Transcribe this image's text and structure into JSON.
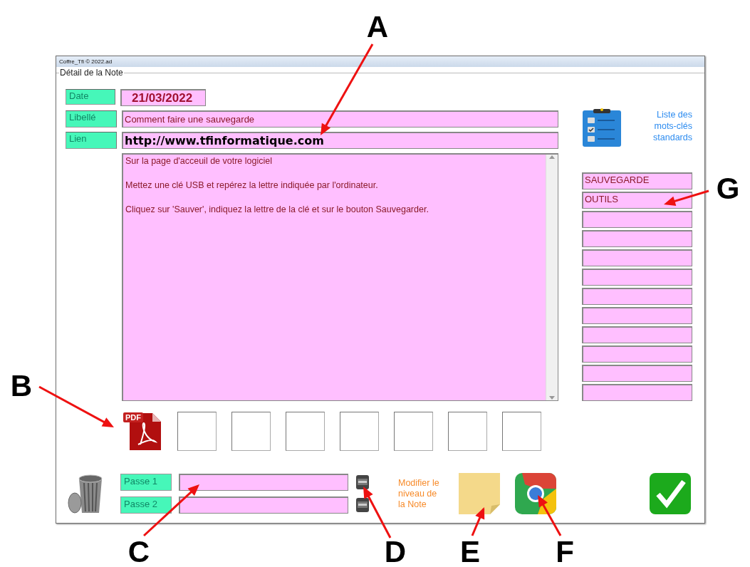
{
  "window": {
    "title": "Coffre_Tfi © 2022.ad"
  },
  "group": {
    "title": "Détail de la Note"
  },
  "fields": [
    {
      "label": "Date",
      "value": "21/03/2022",
      "kind": "date"
    },
    {
      "label": "Libellé",
      "value": "Comment faire une sauvegarde",
      "kind": "text"
    },
    {
      "label": "Lien",
      "value": "http://www.tfinformatique.com",
      "kind": "link"
    }
  ],
  "note": {
    "lines": [
      "Sur la page d'acceuil de votre logiciel",
      "Mettez une clé USB et repérez la lettre indiquée par l'ordinateur.",
      "Cliquez sur 'Sauver', indiquez la lettre de la clé et sur le bouton Sauvegarder."
    ]
  },
  "keywords": {
    "title": "Liste des mots-clés standards",
    "items": [
      "SAUVEGARDE",
      "OUTILS"
    ]
  },
  "attachments": [
    {
      "kind": "pdf",
      "label": "PDF"
    }
  ],
  "passwords": [
    {
      "label": "Passe 1"
    },
    {
      "label": "Passe 2"
    }
  ],
  "level_hint": {
    "lines": [
      "Modifier le",
      "niveau de",
      "la Note"
    ]
  },
  "annotations": [
    {
      "letter": "A"
    },
    {
      "letter": "B"
    },
    {
      "letter": "C"
    },
    {
      "letter": "D"
    },
    {
      "letter": "E"
    },
    {
      "letter": "F"
    },
    {
      "letter": "G"
    }
  ]
}
